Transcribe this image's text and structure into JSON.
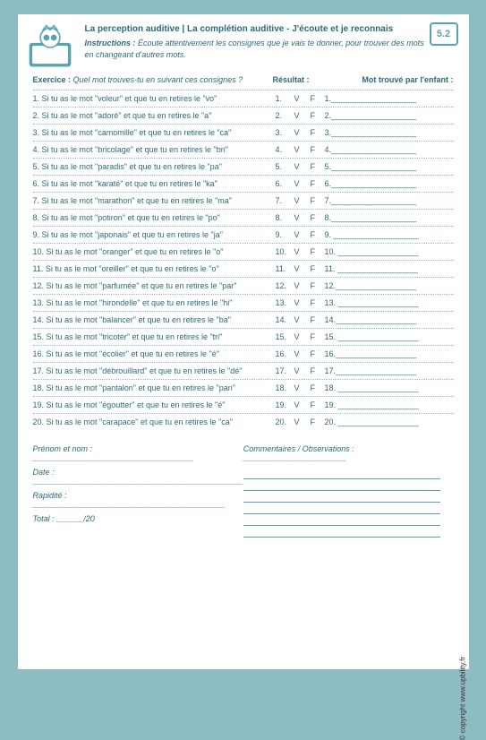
{
  "header": {
    "title": "La perception auditive | La complétion auditive - J'écoute et je reconnais",
    "instructions_label": "Instructions :",
    "instructions": " Écoute attentivement les consignes que je vais te donner, pour trouver des mots en changeant d'autres mots.",
    "badge": "5.2"
  },
  "section": {
    "exercice_label": "Exercice :",
    "exercice": " Quel mot trouves-tu en suivant ces consignes ?",
    "resultat": "Résultat :",
    "mot": "Mot trouvé par l'enfant :"
  },
  "vf": {
    "v": "V",
    "f": "F"
  },
  "items": [
    {
      "n": "1.",
      "q": "Si tu as le mot \"voleur\" et que tu en retires le \"vo\"",
      "a": "1.___________________"
    },
    {
      "n": "2.",
      "q": "Si tu as le mot \"adoré\" et que tu en retires le \"a\"",
      "a": "2.___________________"
    },
    {
      "n": "3.",
      "q": "Si tu as le mot \"camomille\" et que tu en retires le \"ca\"",
      "a": "3.___________________"
    },
    {
      "n": "4.",
      "q": "Si tu as le mot \"bricolage\" et que tu en retires le \"bri\"",
      "a": "4.___________________"
    },
    {
      "n": "5.",
      "q": "Si tu as le mot \"paradis\" et que tu en retires le \"pa\"",
      "a": "5.___________________"
    },
    {
      "n": "6.",
      "q": "Si tu as le mot \"karaté\" et que tu en retires le \"ka\"",
      "a": "6.___________________"
    },
    {
      "n": "7.",
      "q": "Si tu as le mot \"marathon\" et que tu en retires le \"ma\"",
      "a": "7.___________________"
    },
    {
      "n": "8.",
      "q": "Si tu as le mot \"potiron\" et que tu en retires le \"po\"",
      "a": "8.___________________"
    },
    {
      "n": "9.",
      "q": "Si tu as le mot \"japonais\" et que tu en retires le \"ja\"",
      "a": "9. ___________________"
    },
    {
      "n": "10.",
      "q": "Si tu as le mot \"oranger\" et que tu en retires le \"o\"",
      "a": "10. __________________"
    },
    {
      "n": "11.",
      "q": "Si tu as le mot \"oreiller\" et que tu en retires le \"o\"",
      "a": "11. __________________"
    },
    {
      "n": "12.",
      "q": "Si tu as le mot \"parfumée\" et que tu en retires le \"par\"",
      "a": "12.__________________"
    },
    {
      "n": "13.",
      "q": "Si tu as le mot \"hirondelle\" et que tu en retires le \"hi\"",
      "a": "13. __________________"
    },
    {
      "n": "14.",
      "q": "Si tu as le mot \"balancer\" et que tu en retires le \"ba\"",
      "a": "14.__________________"
    },
    {
      "n": "15.",
      "q": "Si tu as le mot \"tricoter\" et que tu en retires le \"tri\"",
      "a": "15. __________________"
    },
    {
      "n": "16.",
      "q": "Si tu as le mot \"écolier\" et que tu en retires le \"é\"",
      "a": "16.__________________"
    },
    {
      "n": "17.",
      "q": "Si tu as le mot \"débrouillard\" et que tu en retires le \"dé\"",
      "a": "17.__________________"
    },
    {
      "n": "18.",
      "q": "Si tu as le mot \"pantalon\" et que tu en retires le \"pan\"",
      "a": "18. __________________"
    },
    {
      "n": "19.",
      "q": "Si tu as le mot \"égoutter\" et que tu en retires le \"é\"",
      "a": "19. __________________"
    },
    {
      "n": "20.",
      "q": "Si tu as le mot \"carapace\" et que tu en retires le \"ca\"",
      "a": "20. __________________"
    }
  ],
  "footer": {
    "prenom": "Prénom et nom : ____________________________________",
    "date": "Date : _______________________________________________",
    "rapidite": "Rapidité : ___________________________________________",
    "total": "Total :     ______/20",
    "comments": "Commentaires / Observations : _______________________",
    "copyright": "© copyright www.upbility.fr"
  }
}
